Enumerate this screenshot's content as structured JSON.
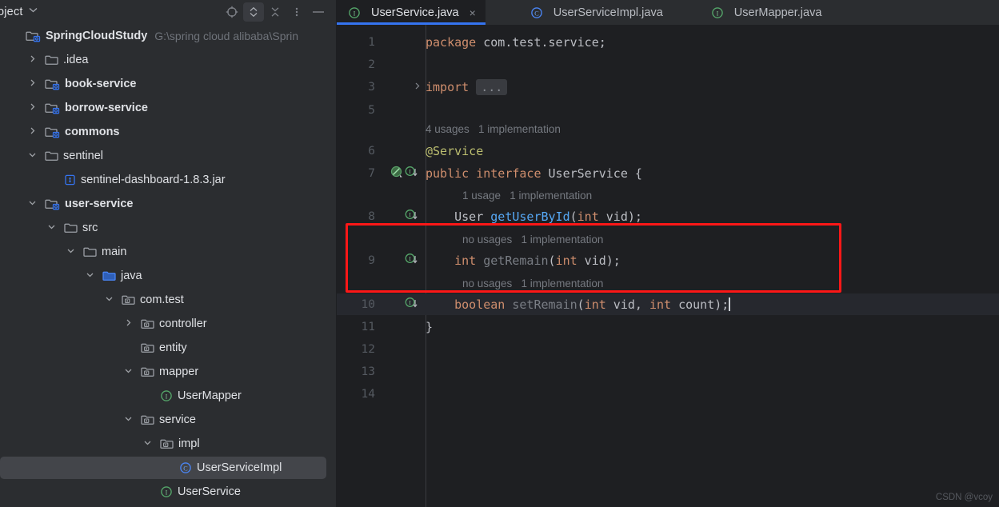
{
  "sidebar": {
    "panel_title": "oject",
    "panel_title_chevron": "chevron-down-icon",
    "tools": [
      {
        "name": "select-opened-file-icon",
        "label": "Select Opened File"
      },
      {
        "name": "expand-collapse-icon",
        "label": "Expand / Collapse"
      },
      {
        "name": "collapse-all-icon",
        "label": "Collapse All"
      },
      {
        "name": "more-options-icon",
        "label": "Options"
      },
      {
        "name": "hide-panel-icon",
        "label": "Hide"
      }
    ],
    "tree": [
      {
        "label": "SpringCloudStudy",
        "hint": "G:\\spring cloud alibaba\\Sprin",
        "icon": "module-folder-icon",
        "arrow": "none",
        "indent": 0,
        "bold": true,
        "selected": false
      },
      {
        "label": ".idea",
        "hint": "",
        "icon": "folder-icon",
        "arrow": "collapsed",
        "indent": 1,
        "bold": false,
        "selected": false
      },
      {
        "label": "book-service",
        "hint": "",
        "icon": "module-folder-icon",
        "arrow": "collapsed",
        "indent": 1,
        "bold": true,
        "selected": false
      },
      {
        "label": "borrow-service",
        "hint": "",
        "icon": "module-folder-icon",
        "arrow": "collapsed",
        "indent": 1,
        "bold": true,
        "selected": false
      },
      {
        "label": "commons",
        "hint": "",
        "icon": "module-folder-icon",
        "arrow": "collapsed",
        "indent": 1,
        "bold": true,
        "selected": false
      },
      {
        "label": "sentinel",
        "hint": "",
        "icon": "folder-icon",
        "arrow": "expanded",
        "indent": 1,
        "bold": false,
        "selected": false
      },
      {
        "label": "sentinel-dashboard-1.8.3.jar",
        "hint": "",
        "icon": "jar-file-icon",
        "arrow": "none",
        "indent": 2,
        "bold": false,
        "selected": false
      },
      {
        "label": "user-service",
        "hint": "",
        "icon": "module-folder-icon",
        "arrow": "expanded",
        "indent": 1,
        "bold": true,
        "selected": false
      },
      {
        "label": "src",
        "hint": "",
        "icon": "folder-icon",
        "arrow": "expanded",
        "indent": 2,
        "bold": false,
        "selected": false
      },
      {
        "label": "main",
        "hint": "",
        "icon": "folder-icon",
        "arrow": "expanded",
        "indent": 3,
        "bold": false,
        "selected": false
      },
      {
        "label": "java",
        "hint": "",
        "icon": "source-root-folder-icon",
        "arrow": "expanded",
        "indent": 4,
        "bold": false,
        "selected": false
      },
      {
        "label": "com.test",
        "hint": "",
        "icon": "package-icon",
        "arrow": "expanded",
        "indent": 5,
        "bold": false,
        "selected": false
      },
      {
        "label": "controller",
        "hint": "",
        "icon": "package-icon",
        "arrow": "collapsed",
        "indent": 6,
        "bold": false,
        "selected": false
      },
      {
        "label": "entity",
        "hint": "",
        "icon": "package-icon",
        "arrow": "none",
        "indent": 6,
        "bold": false,
        "selected": false
      },
      {
        "label": "mapper",
        "hint": "",
        "icon": "package-icon",
        "arrow": "expanded",
        "indent": 6,
        "bold": false,
        "selected": false
      },
      {
        "label": "UserMapper",
        "hint": "",
        "icon": "interface-icon",
        "arrow": "none",
        "indent": 7,
        "bold": false,
        "selected": false
      },
      {
        "label": "service",
        "hint": "",
        "icon": "package-icon",
        "arrow": "expanded",
        "indent": 6,
        "bold": false,
        "selected": false
      },
      {
        "label": "impl",
        "hint": "",
        "icon": "package-icon",
        "arrow": "expanded",
        "indent": 7,
        "bold": false,
        "selected": false
      },
      {
        "label": "UserServiceImpl",
        "hint": "",
        "icon": "class-icon",
        "arrow": "none",
        "indent": 8,
        "bold": false,
        "selected": true
      },
      {
        "label": "UserService",
        "hint": "",
        "icon": "interface-icon",
        "arrow": "none",
        "indent": 7,
        "bold": false,
        "selected": false
      }
    ]
  },
  "editor": {
    "tabs": [
      {
        "label": "UserService.java",
        "icon": "interface-icon",
        "active": true,
        "closable": true,
        "close_glyph": "×"
      },
      {
        "label": "UserServiceImpl.java",
        "icon": "class-icon",
        "active": false,
        "closable": false,
        "close_glyph": ""
      },
      {
        "label": "UserMapper.java",
        "icon": "interface-icon",
        "active": false,
        "closable": false,
        "close_glyph": ""
      }
    ],
    "lines": [
      {
        "num": "1",
        "tokens": [
          {
            "t": "package",
            "c": "kw"
          },
          {
            "t": " com.test.service;",
            "c": "plain"
          }
        ]
      },
      {
        "num": "2",
        "tokens": []
      },
      {
        "num": "3",
        "tokens": [
          {
            "t": "import",
            "c": "kw"
          },
          {
            "t": " ",
            "c": "plain"
          },
          {
            "t": "...",
            "c": "importbox"
          }
        ]
      },
      {
        "num": "5",
        "tokens": []
      },
      {
        "num": "6",
        "tokens": [
          {
            "t": "@Service",
            "c": "ann"
          }
        ]
      },
      {
        "num": "7",
        "tokens": [
          {
            "t": "public interface ",
            "c": "kw"
          },
          {
            "t": "UserService",
            "c": "plain"
          },
          {
            "t": " {",
            "c": "punc"
          }
        ]
      },
      {
        "num": "8",
        "tokens": [
          {
            "t": "    ",
            "c": "plain"
          },
          {
            "t": "User ",
            "c": "plain"
          },
          {
            "t": "getUserById",
            "c": "mtd"
          },
          {
            "t": "(",
            "c": "punc"
          },
          {
            "t": "int",
            "c": "kw"
          },
          {
            "t": " vid);",
            "c": "plain"
          }
        ]
      },
      {
        "num": "9",
        "tokens": [
          {
            "t": "    ",
            "c": "plain"
          },
          {
            "t": "int",
            "c": "kw"
          },
          {
            "t": " ",
            "c": "plain"
          },
          {
            "t": "getRemain",
            "c": "mtd-dim"
          },
          {
            "t": "(",
            "c": "punc"
          },
          {
            "t": "int",
            "c": "kw"
          },
          {
            "t": " vid);",
            "c": "plain"
          }
        ]
      },
      {
        "num": "10",
        "tokens": [
          {
            "t": "    ",
            "c": "plain"
          },
          {
            "t": "boolean",
            "c": "kw"
          },
          {
            "t": " ",
            "c": "plain"
          },
          {
            "t": "setRemain",
            "c": "mtd-dim"
          },
          {
            "t": "(",
            "c": "punc"
          },
          {
            "t": "int",
            "c": "kw"
          },
          {
            "t": " vid, ",
            "c": "plain"
          },
          {
            "t": "int",
            "c": "kw"
          },
          {
            "t": " count);",
            "c": "plain"
          }
        ]
      },
      {
        "num": "11",
        "tokens": [
          {
            "t": "}",
            "c": "punc"
          }
        ]
      },
      {
        "num": "12",
        "tokens": []
      },
      {
        "num": "13",
        "tokens": []
      },
      {
        "num": "14",
        "tokens": []
      }
    ],
    "inlay_hints": [
      {
        "text": "4 usages   1 implementation",
        "indent": 0
      },
      {
        "text": "1 usage   1 implementation",
        "indent": 1
      },
      {
        "text": "no usages   1 implementation",
        "indent": 1
      },
      {
        "text": "no usages   1 implementation",
        "indent": 1
      }
    ],
    "caret_line": "10",
    "fold_marker_line": "3"
  },
  "annotation": {
    "highlight_color": "#fc1717",
    "highlight_label": "red-highlight-box"
  },
  "watermark": {
    "text": "CSDN @vcoy"
  },
  "colors": {
    "accent_blue": "#3574f0",
    "sidebar_bg": "#2b2d30",
    "editor_bg": "#1e1f22",
    "selection_bg": "#43454a",
    "keyword": "#cf8e6d",
    "annotation": "#bcbe70",
    "method": "#56a8f5",
    "method_dim": "#7a7e85",
    "text": "#bcbec4"
  }
}
